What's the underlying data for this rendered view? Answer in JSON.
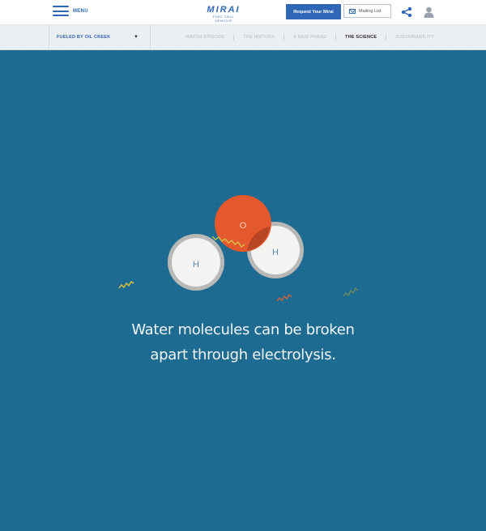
{
  "header": {
    "menu_label": "MENU",
    "logo_main": "MIRAI",
    "logo_sub": "FUEL CELL VEHICLE",
    "request_label": "Request Your Mirai",
    "mailing_label": "Mailing List"
  },
  "subnav": {
    "episode_label": "FUELED BY OIL CREEK",
    "links": [
      {
        "label": "WATCH EPISODE"
      },
      {
        "label": "THE HISTORY"
      },
      {
        "label": "A NEW PHASE"
      },
      {
        "label": "THE SCIENCE"
      },
      {
        "label": "SUSTAINABILITY"
      }
    ],
    "active_index": 3
  },
  "scene": {
    "oxygen_label": "O",
    "hydrogen_left_label": "H",
    "hydrogen_right_label": "H",
    "caption_line1": "Water molecules can be broken",
    "caption_line2": "apart through electrolysis."
  },
  "colors": {
    "brand_blue": "#2f67b6",
    "background_blue": "#1e6b92",
    "oxygen_orange": "#e3582c",
    "hydrogen_white": "#f3f3f1"
  }
}
